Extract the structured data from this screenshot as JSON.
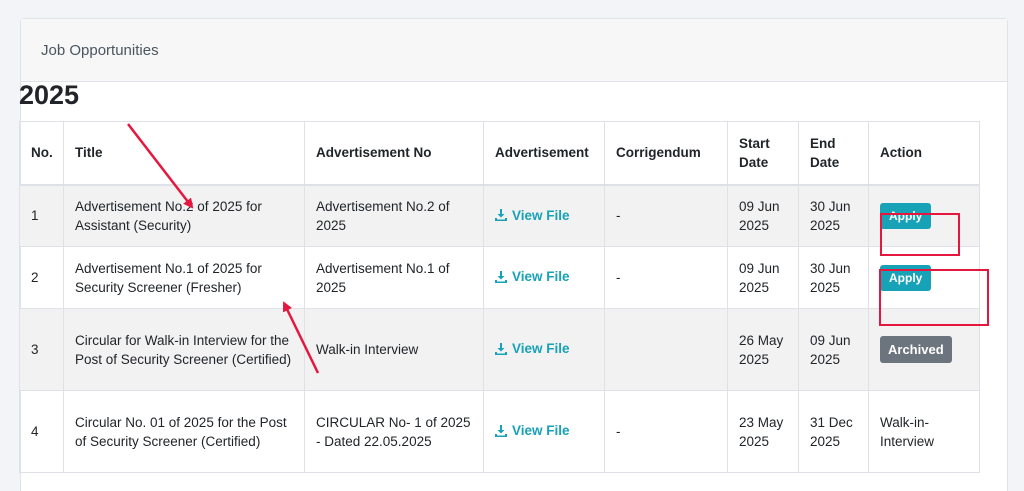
{
  "card": {
    "header_title": "Job Opportunities"
  },
  "year_heading": "2025",
  "table": {
    "headers": {
      "no": "No.",
      "title": "Title",
      "adv_no": "Advertisement No",
      "advertisement": "Advertisement",
      "corrigendum": "Corrigendum",
      "start_date_1": "Start",
      "start_date_2": "Date",
      "end_date_1": "End",
      "end_date_2": "Date",
      "action": "Action"
    },
    "rows": [
      {
        "no": "1",
        "title": "Advertisement No.2 of 2025 for Assistant (Security)",
        "adv_no": "Advertisement No.2 of 2025",
        "view": "View File",
        "corrigendum": "-",
        "start": "09 Jun 2025",
        "end": "30 Jun 2025",
        "action": "Apply"
      },
      {
        "no": "2",
        "title": "Advertisement No.1 of 2025 for Security Screener (Fresher)",
        "adv_no": "Advertisement No.1 of 2025",
        "view": "View File",
        "corrigendum": "-",
        "start": "09 Jun 2025",
        "end": "30 Jun 2025",
        "action": "Apply"
      },
      {
        "no": "3",
        "title": "Circular for Walk-in Interview for the Post of Security Screener (Certified)",
        "adv_no": "Walk-in Interview",
        "view": "View File",
        "corrigendum": "",
        "start": "26 May 2025",
        "end": "09 Jun 2025",
        "action": "Archived"
      },
      {
        "no": "4",
        "title": "Circular No. 01 of 2025 for the Post of Security Screener (Certified)",
        "adv_no": "CIRCULAR No- 1 of 2025 - Dated 22.05.2025",
        "view": "View File",
        "corrigendum": "-",
        "start": "23 May 2025",
        "end": "31 Dec 2025",
        "action": "Walk-in-Interview"
      }
    ]
  },
  "colors": {
    "accent": "#17a2b8",
    "archived": "#6c757d",
    "annotation": "#e5173f"
  }
}
